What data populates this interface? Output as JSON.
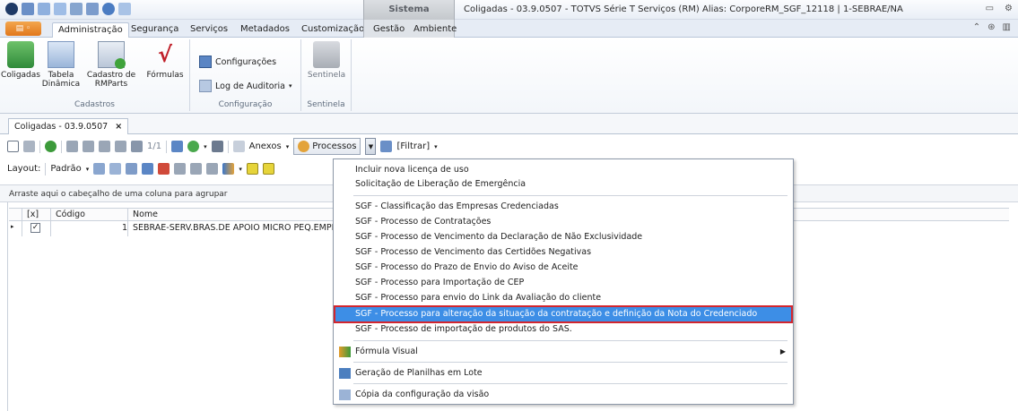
{
  "window": {
    "title": "Coligadas - 03.9.0507 - TOTVS Série T Serviços (RM) Alias: CorporeRM_SGF_12118 | 1-SEBRAE/NA",
    "contextual_header": "Sistema"
  },
  "tabs": [
    "Administração",
    "Segurança",
    "Serviços",
    "Metadados",
    "Customização",
    "Gestão",
    "Ambiente"
  ],
  "ribbon": {
    "cadastros": {
      "label": "Cadastros",
      "buttons": [
        {
          "label": "Coligadas",
          "icon": "building-icon"
        },
        {
          "label": "Tabela Dinâmica",
          "icon": "table-icon"
        },
        {
          "label": "Cadastro de RMParts",
          "icon": "add-window-icon"
        },
        {
          "label": "Fórmulas",
          "icon": "formula-icon"
        }
      ]
    },
    "configuracao": {
      "label": "Configuração",
      "items": [
        {
          "label": "Configurações",
          "icon": "settings-window-icon"
        },
        {
          "label": "Log de Auditoria",
          "icon": "audit-log-icon"
        }
      ]
    },
    "sentinela": {
      "label": "Sentinela",
      "button": "Sentinela"
    }
  },
  "document_tab": {
    "label": "Coligadas - 03.9.0507",
    "close": "×"
  },
  "toolbar1": {
    "pager": "1/1",
    "anexos": "Anexos",
    "processos": "Processos",
    "filtrar": "[Filtrar]"
  },
  "toolbar2": {
    "layout_label": "Layout:",
    "layout_value": "Padrão"
  },
  "group_panel": "Arraste aqui o cabeçalho de uma coluna para agrupar",
  "grid": {
    "columns": [
      "[x]",
      "Código",
      "Nome"
    ],
    "rows": [
      {
        "checked": "✓",
        "codigo": "1",
        "nome": "SEBRAE-SERV.BRAS.DE APOIO MICRO PEQ.EMPR"
      }
    ]
  },
  "menu": {
    "group1": [
      "Incluir nova licença de uso",
      "Solicitação de Liberação de Emergência"
    ],
    "group2": [
      "SGF - Classificação das Empresas Credenciadas",
      "SGF - Processo de Contratações",
      "SGF - Processo de Vencimento da Declaração de Não Exclusividade",
      "SGF - Processo de Vencimento das Certidões Negativas",
      "SGF - Processo do Prazo de Envio do Aviso de Aceite",
      "SGF - Processo para Importação de CEP",
      "SGF - Processo para envio do Link da Avaliação do cliente",
      "SGF - Processo para alteração da situação da contratação e definição da Nota do Credenciado",
      "SGF - Processo de importação de produtos do SAS."
    ],
    "highlighted_index": 7,
    "formula_visual": "Fórmula Visual",
    "geracao": "Geração de Planilhas em Lote",
    "copia": "Cópia da configuração da visão"
  },
  "colors": {
    "highlight": "#3d8ee6",
    "highlight_border": "#d3262e"
  }
}
